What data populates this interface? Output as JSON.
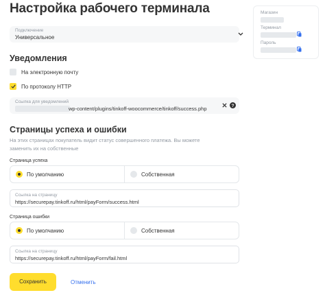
{
  "page": {
    "title": "Настройка рабочего терминала"
  },
  "connection": {
    "label": "Подключение",
    "value": "Универсальное"
  },
  "notifications": {
    "heading": "Уведомления",
    "email_label": "На электронную почту",
    "email_checked": false,
    "http_label": "По протоколу HTTP",
    "http_checked": true,
    "url_field": {
      "label": "Ссылка для уведомлений",
      "value": "wp-content/plugins/tinkoff-woocommerce/tinkoff/success.php"
    }
  },
  "pages": {
    "heading": "Страницы успеха и ошибки",
    "description": "На этих страницах покупатель видит статус совершенного платежа. Вы можете заменить их на собственные",
    "success": {
      "label": "Страница успеха",
      "option_default": "По умолчанию",
      "option_custom": "Собственная",
      "selected": "default",
      "link_label": "Ссылка на страницу",
      "link_value": "https://securepay.tinkoff.ru/html/payForm/success.html"
    },
    "error": {
      "label": "Страница ошибки",
      "option_default": "По умолчанию",
      "option_custom": "Собственная",
      "selected": "default",
      "link_label": "Ссылка на страницу",
      "link_value": "https://securepay.tinkoff.ru/html/payForm/fail.html"
    }
  },
  "actions": {
    "save_label": "Сохранить",
    "cancel_label": "Отменить"
  },
  "side_panel": {
    "shop_label": "Магазин",
    "terminal_label": "Терминал",
    "password_label": "Пароль"
  },
  "colors": {
    "accent": "#ffdd2d",
    "link": "#336fee",
    "field_bg": "#f6f7f8",
    "muted_text": "#9299a2"
  },
  "icons": {
    "select_chevron": "chevron-down-icon",
    "clear": "close-icon",
    "help": "help-icon",
    "copy": "copy-icon"
  }
}
